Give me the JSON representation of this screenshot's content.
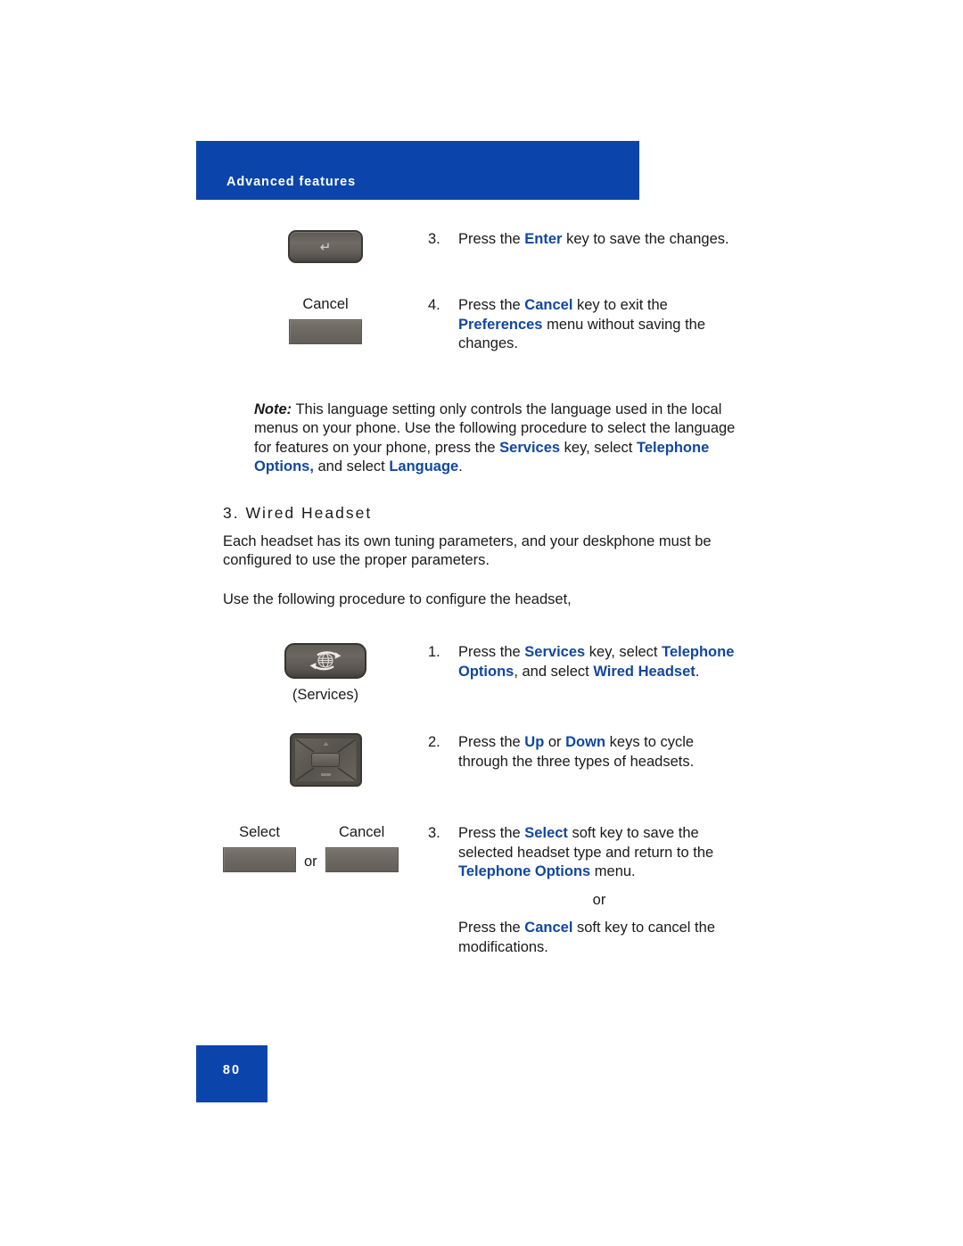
{
  "header": {
    "title": "Advanced features",
    "banner_color": "#0B45AB"
  },
  "accent_blue": "#11479F",
  "steps_preferences": [
    {
      "number": "3.",
      "icon_name": "enter-key",
      "icon_glyph": "↵",
      "key_label_above": "",
      "key_label_below": "",
      "text_segments": [
        {
          "t": "Press the ",
          "style": "plain"
        },
        {
          "t": "Enter",
          "style": "blue"
        },
        {
          "t": " key to save the changes.",
          "style": "plain"
        }
      ]
    },
    {
      "number": "4.",
      "icon_name": "cancel-soft-key",
      "icon_glyph": "",
      "key_label_above": "Cancel",
      "key_label_below": "",
      "text_segments": [
        {
          "t": "Press the ",
          "style": "plain"
        },
        {
          "t": "Cancel",
          "style": "blue"
        },
        {
          "t": " key to exit the ",
          "style": "plain"
        },
        {
          "t": "Preferences",
          "style": "blue"
        },
        {
          "t": " menu without saving the changes.",
          "style": "plain"
        }
      ]
    }
  ],
  "note": {
    "lead": "Note:",
    "segments": [
      {
        "t": " This language setting only controls the language used in the local menus on your phone. Use the following procedure to select the language for features on your phone, press the ",
        "style": "plain"
      },
      {
        "t": "Services",
        "style": "blue"
      },
      {
        "t": " key, select ",
        "style": "plain"
      },
      {
        "t": "Telephone Options,",
        "style": "blue"
      },
      {
        "t": " and select ",
        "style": "plain"
      },
      {
        "t": "Language",
        "style": "blue"
      },
      {
        "t": ".",
        "style": "plain"
      }
    ]
  },
  "section": {
    "heading": "3. Wired Headset",
    "paragraph_1": "Each headset has its own tuning parameters, and your deskphone must be configured to use the proper parameters.",
    "paragraph_2": "Use the following procedure to configure the headset,"
  },
  "steps_headset": [
    {
      "number": "1.",
      "icon_name": "services-key",
      "key_label_above": "",
      "key_label_below": "(Services)",
      "text_segments": [
        {
          "t": "Press the ",
          "style": "plain"
        },
        {
          "t": "Services",
          "style": "blue"
        },
        {
          "t": " key, select ",
          "style": "plain"
        },
        {
          "t": "Telephone Options",
          "style": "blue"
        },
        {
          "t": ", and select ",
          "style": "plain"
        },
        {
          "t": "Wired Headset",
          "style": "blue"
        },
        {
          "t": ".",
          "style": "plain"
        }
      ]
    },
    {
      "number": "2.",
      "icon_name": "navigation-cluster-key",
      "key_label_above": "",
      "key_label_below": "",
      "text_segments": [
        {
          "t": "Press the ",
          "style": "plain"
        },
        {
          "t": "Up",
          "style": "blue"
        },
        {
          "t": " or ",
          "style": "plain"
        },
        {
          "t": "Down",
          "style": "blue"
        },
        {
          "t": " keys to cycle through the three types of headsets.",
          "style": "plain"
        }
      ]
    },
    {
      "number": "3.",
      "icon_name": "select-or-cancel-soft-keys",
      "key_label_select": "Select",
      "key_label_cancel": "Cancel",
      "or_separator": "or",
      "text_segments": [
        {
          "t": "Press the ",
          "style": "plain"
        },
        {
          "t": "Select",
          "style": "blue"
        },
        {
          "t": " soft key to save the selected headset type and return to the ",
          "style": "plain"
        },
        {
          "t": "Telephone Options",
          "style": "blue"
        },
        {
          "t": " menu.",
          "style": "plain"
        }
      ],
      "middle_or": "or",
      "text_segments_2": [
        {
          "t": "Press the ",
          "style": "plain"
        },
        {
          "t": "Cancel",
          "style": "blue"
        },
        {
          "t": " soft key to cancel the modifications.",
          "style": "plain"
        }
      ]
    }
  ],
  "footer": {
    "page_number": "80"
  }
}
